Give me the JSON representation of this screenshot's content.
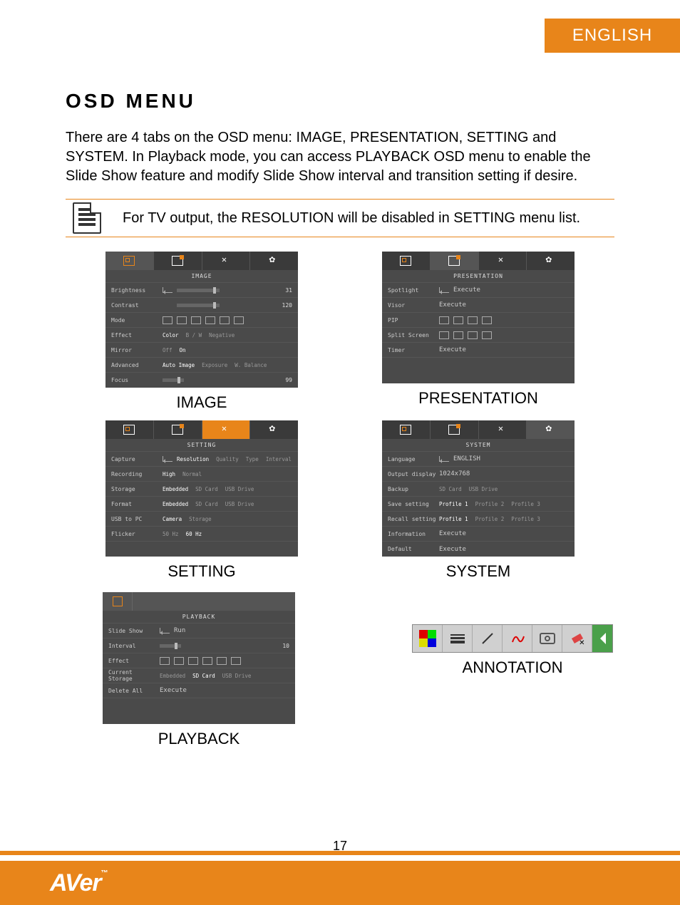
{
  "lang_tab": "ENGLISH",
  "heading": "OSD MENU",
  "intro": "There are 4 tabs on the OSD menu: IMAGE, PRESENTATION, SETTING and SYSTEM. In Playback mode, you can access PLAYBACK OSD menu to enable the Slide Show feature and modify Slide Show interval and transition setting if desire.",
  "note": "For TV output, the RESOLUTION will be disabled in SETTING menu list.",
  "captions": {
    "image": "IMAGE",
    "presentation": "PRESENTATION",
    "setting": "SETTING",
    "system": "SYSTEM",
    "playback": "PLAYBACK",
    "annotation": "ANNOTATION"
  },
  "image_panel": {
    "title": "IMAGE",
    "rows": {
      "brightness": {
        "label": "Brightness",
        "value": "31"
      },
      "contrast": {
        "label": "Contrast",
        "value": "120"
      },
      "mode": {
        "label": "Mode"
      },
      "effect": {
        "label": "Effect",
        "opts": [
          "Color",
          "B / W",
          "Negative"
        ],
        "sel": 0
      },
      "mirror": {
        "label": "Mirror",
        "opts": [
          "Off",
          "On"
        ],
        "sel": 1
      },
      "advanced": {
        "label": "Advanced",
        "opts": [
          "Auto Image",
          "Exposure",
          "W. Balance"
        ],
        "sel": 0
      },
      "focus": {
        "label": "Focus",
        "value": "99"
      }
    }
  },
  "presentation_panel": {
    "title": "PRESENTATION",
    "rows": {
      "spotlight": {
        "label": "Spotlight",
        "opt": "Execute"
      },
      "visor": {
        "label": "Visor",
        "opt": "Execute"
      },
      "pip": {
        "label": "PIP"
      },
      "split": {
        "label": "Split Screen"
      },
      "timer": {
        "label": "Timer",
        "opt": "Execute"
      }
    }
  },
  "setting_panel": {
    "title": "SETTING",
    "rows": {
      "capture": {
        "label": "Capture",
        "opts": [
          "Resolution",
          "Quality",
          "Type",
          "Interval"
        ],
        "sel": 0
      },
      "recording": {
        "label": "Recording",
        "opts": [
          "High",
          "Normal"
        ],
        "sel": 0
      },
      "storage": {
        "label": "Storage",
        "opts": [
          "Embedded",
          "SD Card",
          "USB Drive"
        ],
        "sel": 0
      },
      "format": {
        "label": "Format",
        "opts": [
          "Embedded",
          "SD Card",
          "USB Drive"
        ],
        "sel": 0
      },
      "usb": {
        "label": "USB to PC",
        "opts": [
          "Camera",
          "Storage"
        ],
        "sel": 0
      },
      "flicker": {
        "label": "Flicker",
        "opts": [
          "50 Hz",
          "60 Hz"
        ],
        "sel": 1
      }
    }
  },
  "system_panel": {
    "title": "SYSTEM",
    "rows": {
      "language": {
        "label": "Language",
        "opt": "ENGLISH"
      },
      "output": {
        "label": "Output display",
        "opt": "1024x768"
      },
      "backup": {
        "label": "Backup",
        "opts": [
          "SD Card",
          "USB Drive"
        ]
      },
      "save": {
        "label": "Save setting",
        "opts": [
          "Profile 1",
          "Profile 2",
          "Profile 3"
        ],
        "sel": 0
      },
      "recall": {
        "label": "Recall setting",
        "opts": [
          "Profile 1",
          "Profile 2",
          "Profile 3"
        ],
        "sel": 0
      },
      "info": {
        "label": "Information",
        "opt": "Execute"
      },
      "default": {
        "label": "Default",
        "opt": "Execute"
      }
    }
  },
  "playback_panel": {
    "title": "PLAYBACK",
    "rows": {
      "slideshow": {
        "label": "Slide Show",
        "opt": "Run"
      },
      "interval": {
        "label": "Interval",
        "value": "10"
      },
      "effect": {
        "label": "Effect"
      },
      "storage": {
        "label": "Current Storage",
        "opts": [
          "Embedded",
          "SD Card",
          "USB Drive"
        ],
        "sel": 1
      },
      "delete": {
        "label": "Delete All",
        "opt": "Execute"
      }
    }
  },
  "page_number": "17",
  "logo": "AVer"
}
